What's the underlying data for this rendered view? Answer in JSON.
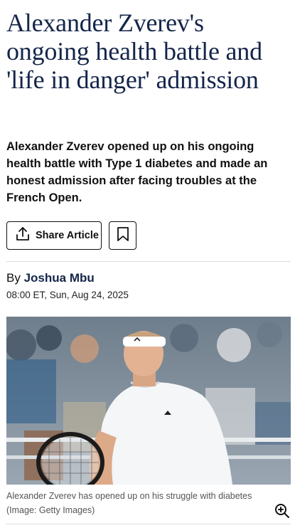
{
  "article": {
    "headline": "Alexander Zverev's ongoing health battle and 'life in danger' admission",
    "standfirst": "Alexander Zverev opened up on his ongoing health battle with Type 1 diabetes and made an honest admission after facing troubles at the French Open.",
    "share_label": "Share Article",
    "byline_prefix": "By",
    "author": "Joshua Mbu",
    "timestamp": "08:00 ET, Sun, Aug 24, 2025",
    "caption": "Alexander Zverev has opened up on his struggle with diabetes",
    "credit": "(Image: Getty Images)"
  },
  "icons": {
    "share": "share-icon",
    "bookmark": "bookmark-icon",
    "zoom": "zoom-in-icon"
  },
  "colors": {
    "headline": "#14254a",
    "text": "#111111",
    "caption": "#555555",
    "divider": "#dddddd"
  }
}
